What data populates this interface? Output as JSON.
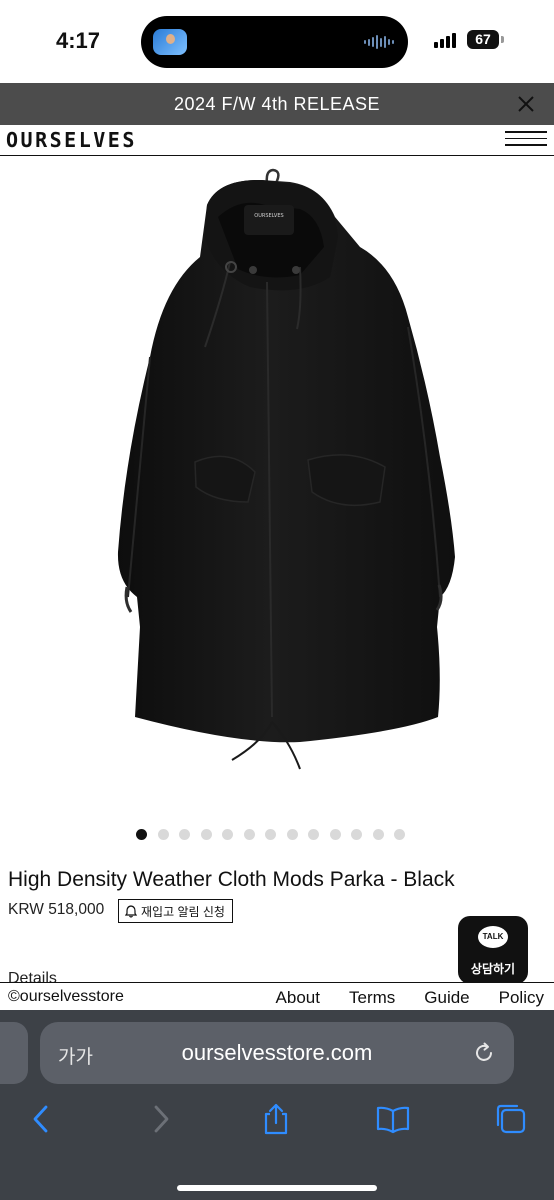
{
  "status_bar": {
    "time": "4:17",
    "battery": "67"
  },
  "promo": {
    "text": "2024 F/W 4th RELEASE"
  },
  "header": {
    "logo": "OURSELVES"
  },
  "product": {
    "title": "High Density Weather Cloth Mods Parka - Black",
    "price": "KRW 518,000",
    "restock_label": "재입고 알림 신청",
    "details_tab": "Details",
    "gallery": {
      "total_images": 13,
      "active_index": 0
    },
    "hanger_tag": "OURSELVES"
  },
  "chat": {
    "bubble": "TALK",
    "label": "상담하기"
  },
  "footer": {
    "copyright": "©ourselvesstore",
    "links": [
      "About",
      "Terms",
      "Guide",
      "Policy"
    ]
  },
  "browser": {
    "aa_label": "가가",
    "url": "ourselvesstore.com"
  },
  "colors": {
    "promo_bg": "#4c4c4c",
    "browser_bg": "#3d4147",
    "ios_blue": "#2f8cff"
  }
}
